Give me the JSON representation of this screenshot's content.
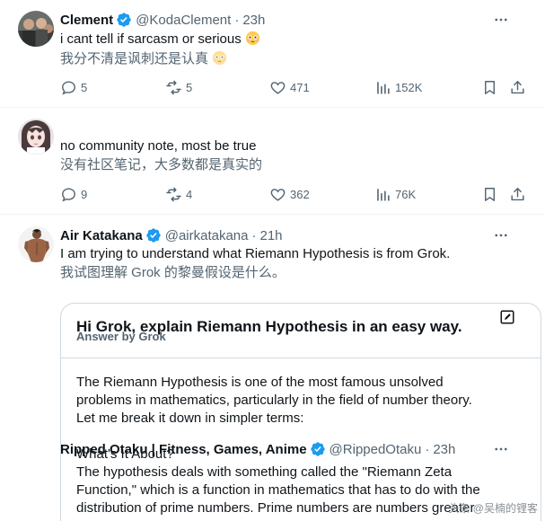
{
  "tweets": [
    {
      "name": "Clement",
      "handle": "@KodaClement",
      "separator": "·",
      "time": "23h",
      "text": "i cant tell if sarcasm or serious",
      "translation": "我分不清是讽刺还是认真",
      "emoji_icon": "flushed-face-emoji",
      "replies": "5",
      "retweets": "5",
      "likes": "471",
      "views": "152K"
    },
    {
      "name": "Air Katakana",
      "handle": "@airkatakana",
      "separator": "·",
      "time": "21h",
      "text": "no community note, most be true",
      "translation": "没有社区笔记，大多数都是真实的",
      "replies": "9",
      "retweets": "4",
      "likes": "362",
      "views": "76K"
    },
    {
      "name": "Ripped Otaku | Fitness, Games, Anime",
      "handle": "@RippedOtaku",
      "separator": "·",
      "time": "23h",
      "text": "I am trying to understand what Riemann Hypothesis is from Grok.",
      "translation": "我试图理解 Grok 的黎曼假设是什么。"
    }
  ],
  "grok": {
    "prompt": "Hi Grok, explain Riemann Hypothesis in an easy way.",
    "answer_label": "Answer by Grok",
    "answer_lines": [
      "The Riemann Hypothesis is one of the most famous unsolved",
      "problems in mathematics, particularly in the field of number theory.",
      "Let me break it down in simpler terms:",
      "",
      "What's It About?",
      "The hypothesis deals with something called the \"Riemann Zeta",
      "Function,\" which is a function in mathematics that has to do with the",
      "distribution of prime numbers. Prime numbers are numbers greater"
    ]
  },
  "watermark": "头条 @吴楠的锂客",
  "colors": {
    "text": "#0f1419",
    "muted": "#536471",
    "verified": "#1d9bf0",
    "border": "#eff3f4"
  }
}
